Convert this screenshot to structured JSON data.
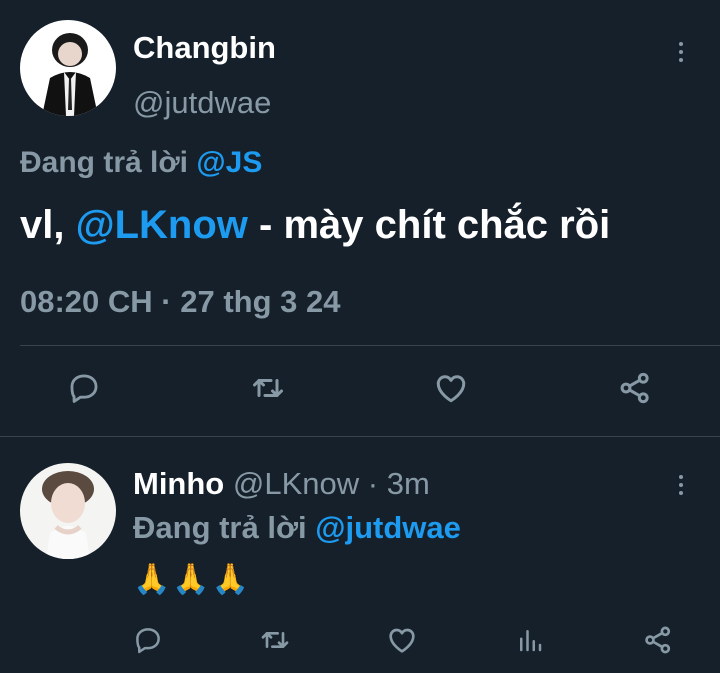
{
  "colors": {
    "background": "#15202b",
    "text": "#ffffff",
    "muted": "#8899a6",
    "link": "#1d9bf0",
    "divider": "#38444d"
  },
  "main_tweet": {
    "display_name": "Changbin",
    "handle": "@jutdwae",
    "replying_prefix": "Đang trả lời",
    "replying_to": "@JS",
    "text_before": "vl,",
    "text_mention": "@LKnow",
    "text_after": "- mày chít chắc rồi",
    "timestamp": "08:20 CH · 27 thg 3 24",
    "actions": [
      "reply-icon",
      "retweet-icon",
      "like-icon",
      "share-icon"
    ]
  },
  "reply_tweet": {
    "display_name": "Minho",
    "handle": "@LKnow",
    "separator": "·",
    "time_ago": "3m",
    "replying_prefix": "Đang trả lời",
    "replying_to": "@jutdwae",
    "text": "🙏🙏🙏",
    "actions": [
      "reply-icon",
      "retweet-icon",
      "like-icon",
      "analytics-icon",
      "share-icon"
    ]
  }
}
